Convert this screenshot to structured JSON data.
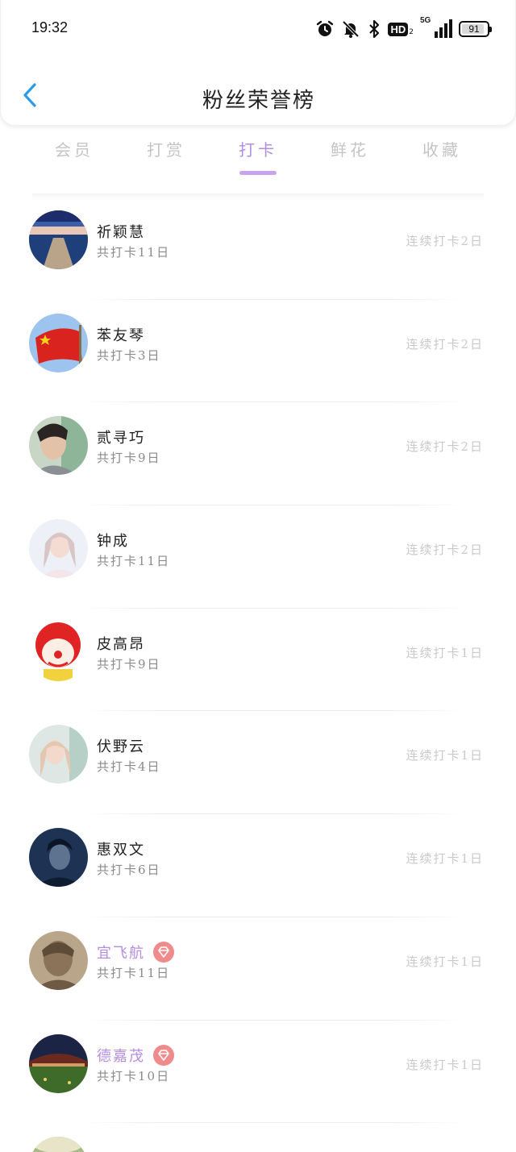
{
  "status_bar": {
    "time": "19:32",
    "network": "5G",
    "hd_label": "HD",
    "hd_sub": "2",
    "battery": "91",
    "battery_level": 0.91,
    "icons": [
      "alarm-icon",
      "bell-off-icon",
      "bluetooth-icon",
      "hd-icon",
      "signal-icon",
      "battery-icon"
    ]
  },
  "nav": {
    "back_icon": "chevron-left-icon",
    "title": "粉丝荣誉榜"
  },
  "tabs": [
    {
      "label": "会员",
      "active": false
    },
    {
      "label": "打赏",
      "active": false
    },
    {
      "label": "打卡",
      "active": true
    },
    {
      "label": "鲜花",
      "active": false
    },
    {
      "label": "收藏",
      "active": false
    }
  ],
  "colors": {
    "accent": "#b58de0",
    "back_arrow": "#2b9be8",
    "badge": "#f08b8b",
    "muted": "#c9c9c9"
  },
  "fans": [
    {
      "name": "祈颖慧",
      "total": "共打卡11日",
      "streak": "连续打卡2日",
      "vip": false,
      "avatar": "lake-pier-photo"
    },
    {
      "name": "苯友琴",
      "total": "共打卡3日",
      "streak": "连续打卡2日",
      "vip": false,
      "avatar": "red-flag-photo"
    },
    {
      "name": "贰寻巧",
      "total": "共打卡9日",
      "streak": "连续打卡2日",
      "vip": false,
      "avatar": "man-portrait-photo"
    },
    {
      "name": "钟成",
      "total": "共打卡11日",
      "streak": "连续打卡2日",
      "vip": false,
      "avatar": "girl-portrait-photo"
    },
    {
      "name": "皮高昂",
      "total": "共打卡9日",
      "streak": "连续打卡1日",
      "vip": false,
      "avatar": "clown-cartoon"
    },
    {
      "name": "伏野云",
      "total": "共打卡4日",
      "streak": "连续打卡1日",
      "vip": false,
      "avatar": "woman-portrait-photo"
    },
    {
      "name": "惠双文",
      "total": "共打卡6日",
      "streak": "连续打卡1日",
      "vip": false,
      "avatar": "man-blue-photo"
    },
    {
      "name": "宜飞航",
      "total": "共打卡11日",
      "streak": "连续打卡1日",
      "vip": true,
      "avatar": "soldier-photo"
    },
    {
      "name": "德嘉茂",
      "total": "共打卡10日",
      "streak": "连续打卡1日",
      "vip": true,
      "avatar": "bridge-field-photo"
    }
  ]
}
